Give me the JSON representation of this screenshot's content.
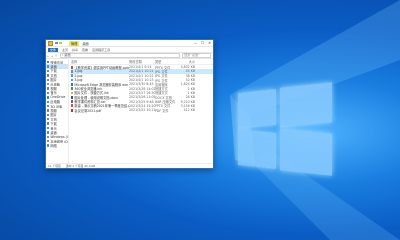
{
  "desktop": {
    "background_color": "#0a5cc4",
    "logo": "windows-logo"
  },
  "window": {
    "title_highlight": "管理",
    "title": "桌面",
    "controls": [
      "—",
      "☐",
      "✕"
    ],
    "ribbon_tabs": [
      "文件",
      "主页",
      "共享",
      "查看",
      "应用程序工具"
    ],
    "address": "› 桌面",
    "search_placeholder": "搜索\"桌面\""
  },
  "navpane": {
    "items": [
      {
        "label": "快速访问",
        "color": "#2f7fd3"
      },
      {
        "label": "桌面",
        "color": "#3a8ee0"
      },
      {
        "label": "下载",
        "color": "#3a8ee0"
      },
      {
        "label": "文档",
        "color": "#7a7a7a"
      },
      {
        "label": "图片",
        "color": "#3a8ee0"
      },
      {
        "label": "此电脑",
        "color": "#5a9bd8"
      },
      {
        "label": "视频",
        "color": "#7a7a7a"
      },
      {
        "label": "音乐",
        "color": "#3a8ee0"
      },
      {
        "label": "OneDrive",
        "color": "#2f7fd3"
      },
      {
        "label": "此电脑",
        "color": "#4a8ccf"
      },
      {
        "label": "3D 对象",
        "color": "#3a8ee0"
      },
      {
        "label": "视频",
        "color": "#7a7a7a"
      },
      {
        "label": "图片",
        "color": "#3a8ee0"
      },
      {
        "label": "文档",
        "color": "#7a7a7a"
      },
      {
        "label": "下载",
        "color": "#3a8ee0"
      },
      {
        "label": "音乐",
        "color": "#3a8ee0"
      },
      {
        "label": "桌面",
        "color": "#3a8ee0"
      },
      {
        "label": "Windows (C:)",
        "color": "#6a8cb0"
      },
      {
        "label": "本地磁盘 (D:)",
        "color": "#6a8cb0"
      },
      {
        "label": "网络",
        "color": "#4a8ccf"
      }
    ],
    "selected_index": 1
  },
  "files": {
    "headers": {
      "name": "名称",
      "date": "修改日期",
      "type": "类型",
      "size": "大小"
    },
    "rows": [
      {
        "name": "【教学资源】超实用PPT动画教程.pptx",
        "date": "2021/4/1 9:14",
        "type": "PPTX 文件",
        "size": "4,832 KB",
        "color": "#d2502a"
      },
      {
        "name": "1.jpg",
        "date": "2021/4/1 10:21",
        "type": "JPG 文件",
        "size": "45 KB",
        "color": "#4a9ad8"
      },
      {
        "name": "2.jpg",
        "date": "2021/4/1 10:22",
        "type": "JPG 文件",
        "size": "38 KB",
        "color": "#4a9ad8"
      },
      {
        "name": "3.jpg",
        "date": "2021/4/1 10:23",
        "type": "JPG 文件",
        "size": "52 KB",
        "color": "#4a9ad8"
      },
      {
        "name": "Microsoft Edge 浏览器安装程序 exe",
        "date": "2021/3/30 8:45",
        "type": "应用程序",
        "size": "1,624 KB",
        "color": "#2a7ad0"
      },
      {
        "name": "360安全浏览器.lnk",
        "date": "2021/3/28 14:02",
        "type": "快捷方式",
        "size": "2 KB",
        "color": "#3aa04a"
      },
      {
        "name": "图片文件 - 快捷方式.lnk",
        "date": "2021/3/27 16:30",
        "type": "快捷方式",
        "size": "1 KB",
        "color": "#e0b040"
      },
      {
        "name": "图片处理 - 使用说明文档.docx",
        "date": "2021/3/26 11:05",
        "type": "DOCX 文档",
        "size": "28 KB",
        "color": "#2b5797"
      },
      {
        "name": "教学课件资料汇总.rar",
        "date": "2021/3/25 9:48",
        "type": "RAR 压缩文件",
        "size": "9,210 KB",
        "color": "#8a4aa8"
      },
      {
        "name": "新建 - 演示文稿2021年第一季度总结.pptx",
        "date": "2021/3/24 15:20",
        "type": "PPTX 文件",
        "size": "3,156 KB",
        "color": "#d2502a"
      },
      {
        "name": "会议记录2021.pdf",
        "date": "2021/3/22 10:11",
        "type": "PDF 文件",
        "size": "412 KB",
        "color": "#c8312a"
      }
    ],
    "selected_index": 1
  },
  "statusbar": {
    "count": "11 个项目",
    "selected": "选中 1 个项目 45.0 KB"
  }
}
